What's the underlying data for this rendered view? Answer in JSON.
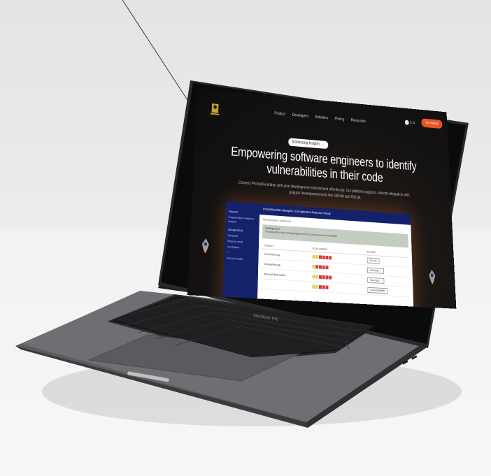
{
  "nav": {
    "links": [
      "Product",
      "Developers",
      "Solutions",
      "Pricing",
      "Resources"
    ],
    "github_count": "2.1k",
    "cta_label": "Get started"
  },
  "badge": {
    "label": "Introducing Insights",
    "arrow": "→"
  },
  "hero": {
    "headline": "Empowering software engineers to identify vulnerabilities in their code",
    "subtext": "Connect PromptGuardian with your development environment effortlessly. Our platform supports smooth integration with popular development tools like GitHub and GitLab."
  },
  "mockup": {
    "topbar_title": "PromptGuardian Managers LLM Application Protection Ready",
    "crumb": "Pending Issues  /  Dashboard",
    "band_title": "Pending Issues",
    "band_text": "PromptGuardian tracks and flags flagged (AFs) in the prompt process vulnerabilities",
    "sidebar": {
      "section1": "PROJECT",
      "items1": [
        "Company Name / Analytics & Business"
      ],
      "section2": "ORGANIZATION",
      "items2": [
        "Dashboard",
        "Resource Library",
        "LLM Analysis",
        "+",
        "Add LLM Checker"
      ]
    },
    "table_headers": [
      "PROJECT",
      "CODE & ISSUES",
      "ACTIONS"
    ],
    "rows": [
      {
        "name": "onProvidence.app",
        "action": "Re-scan"
      },
      {
        "name": "Domingo/Main.app",
        "action": "View Issue →"
      },
      {
        "name": "Welcome/Github.website",
        "action": "View Issue →"
      },
      {
        "name": "",
        "action": "Fix Vulnerabilities"
      }
    ]
  },
  "laptop": {
    "label": "MacBook Pro"
  },
  "colors": {
    "accent": "#e85423",
    "sidebar": "#14216b",
    "screen_bg": "#151312"
  }
}
